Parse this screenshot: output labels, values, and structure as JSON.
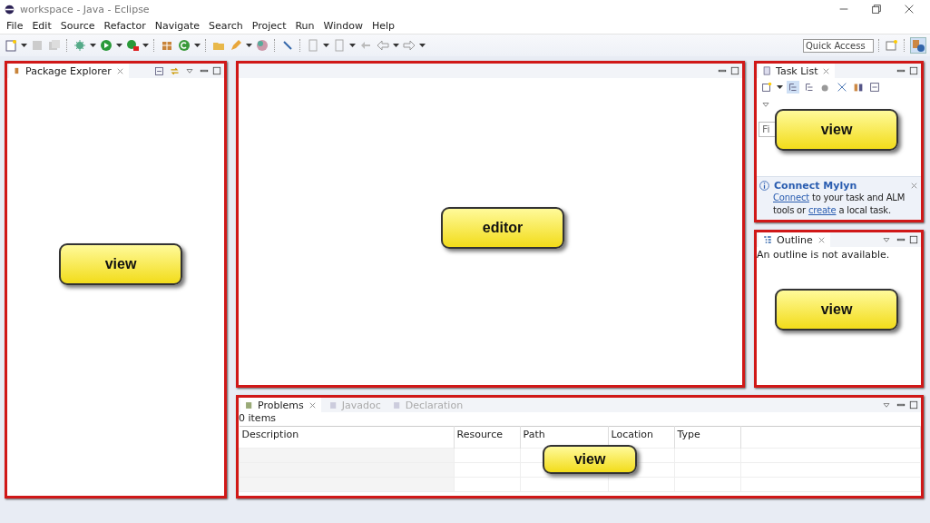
{
  "window": {
    "title": "workspace - Java - Eclipse"
  },
  "menu": [
    "File",
    "Edit",
    "Source",
    "Refactor",
    "Navigate",
    "Search",
    "Project",
    "Run",
    "Window",
    "Help"
  ],
  "quick_access": {
    "placeholder": "Quick Access"
  },
  "package_explorer": {
    "tab": "Package Explorer",
    "callout": "view"
  },
  "editor": {
    "callout": "editor"
  },
  "task_list": {
    "tab": "Task List",
    "find_field": {
      "placeholder": "Fi"
    },
    "callout": "view",
    "mylyn": {
      "title": "Connect Mylyn",
      "message": [
        {
          "kind": "link",
          "text": "Connect"
        },
        {
          "kind": "text",
          "text": " to your task and ALM tools or "
        },
        {
          "kind": "link",
          "text": "create"
        },
        {
          "kind": "text",
          "text": " a local task."
        }
      ]
    }
  },
  "outline": {
    "tab": "Outline",
    "message": "An outline is not available.",
    "callout": "view"
  },
  "bottom": {
    "tabs": [
      {
        "label": "Problems",
        "selected": true
      },
      {
        "label": "Javadoc",
        "selected": false
      },
      {
        "label": "Declaration",
        "selected": false
      }
    ],
    "summary": "0 items",
    "columns": [
      "Description",
      "Resource",
      "Path",
      "Location",
      "Type"
    ],
    "callout": "view"
  }
}
